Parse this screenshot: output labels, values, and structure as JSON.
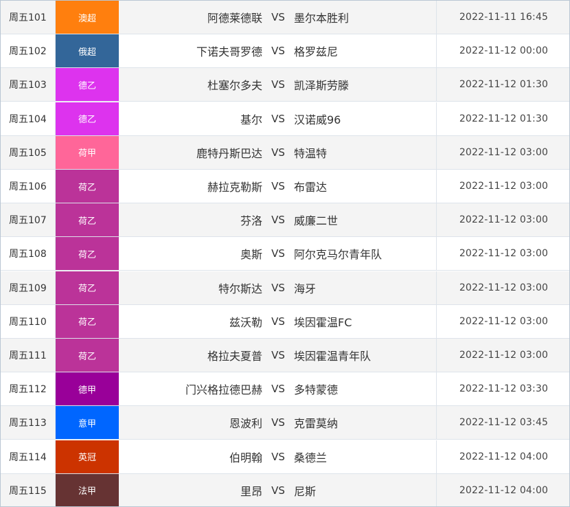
{
  "matches": [
    {
      "id": "周五101",
      "league": "澳超",
      "color": "#ff7f0e",
      "home": "阿德莱德联",
      "vs": "VS",
      "away": "墨尔本胜利",
      "time": "2022-11-11 16:45"
    },
    {
      "id": "周五102",
      "league": "俄超",
      "color": "#336699",
      "home": "下诺夫哥罗德",
      "vs": "VS",
      "away": "格罗兹尼",
      "time": "2022-11-12 00:00"
    },
    {
      "id": "周五103",
      "league": "德乙",
      "color": "#dd33ee",
      "home": "杜塞尔多夫",
      "vs": "VS",
      "away": "凯泽斯劳滕",
      "time": "2022-11-12 01:30"
    },
    {
      "id": "周五104",
      "league": "德乙",
      "color": "#dd33ee",
      "home": "基尔",
      "vs": "VS",
      "away": "汉诺威96",
      "time": "2022-11-12 01:30"
    },
    {
      "id": "周五105",
      "league": "荷甲",
      "color": "#ff6699",
      "home": "鹿特丹斯巴达",
      "vs": "VS",
      "away": "特温特",
      "time": "2022-11-12 03:00"
    },
    {
      "id": "周五106",
      "league": "荷乙",
      "color": "#bb3399",
      "home": "赫拉克勒斯",
      "vs": "VS",
      "away": "布雷达",
      "time": "2022-11-12 03:00"
    },
    {
      "id": "周五107",
      "league": "荷乙",
      "color": "#bb3399",
      "home": "芬洛",
      "vs": "VS",
      "away": "威廉二世",
      "time": "2022-11-12 03:00"
    },
    {
      "id": "周五108",
      "league": "荷乙",
      "color": "#bb3399",
      "home": "奥斯",
      "vs": "VS",
      "away": "阿尔克马尔青年队",
      "time": "2022-11-12 03:00"
    },
    {
      "id": "周五109",
      "league": "荷乙",
      "color": "#bb3399",
      "home": "特尔斯达",
      "vs": "VS",
      "away": "海牙",
      "time": "2022-11-12 03:00"
    },
    {
      "id": "周五110",
      "league": "荷乙",
      "color": "#bb3399",
      "home": "兹沃勒",
      "vs": "VS",
      "away": "埃因霍温FC",
      "time": "2022-11-12 03:00"
    },
    {
      "id": "周五111",
      "league": "荷乙",
      "color": "#bb3399",
      "home": "格拉夫夏普",
      "vs": "VS",
      "away": "埃因霍温青年队",
      "time": "2022-11-12 03:00"
    },
    {
      "id": "周五112",
      "league": "德甲",
      "color": "#990099",
      "home": "门兴格拉德巴赫",
      "vs": "VS",
      "away": "多特蒙德",
      "time": "2022-11-12 03:30"
    },
    {
      "id": "周五113",
      "league": "意甲",
      "color": "#0066ff",
      "home": "恩波利",
      "vs": "VS",
      "away": "克雷莫纳",
      "time": "2022-11-12 03:45"
    },
    {
      "id": "周五114",
      "league": "英冠",
      "color": "#cc3300",
      "home": "伯明翰",
      "vs": "VS",
      "away": "桑德兰",
      "time": "2022-11-12 04:00"
    },
    {
      "id": "周五115",
      "league": "法甲",
      "color": "#663333",
      "home": "里昂",
      "vs": "VS",
      "away": "尼斯",
      "time": "2022-11-12 04:00"
    }
  ]
}
